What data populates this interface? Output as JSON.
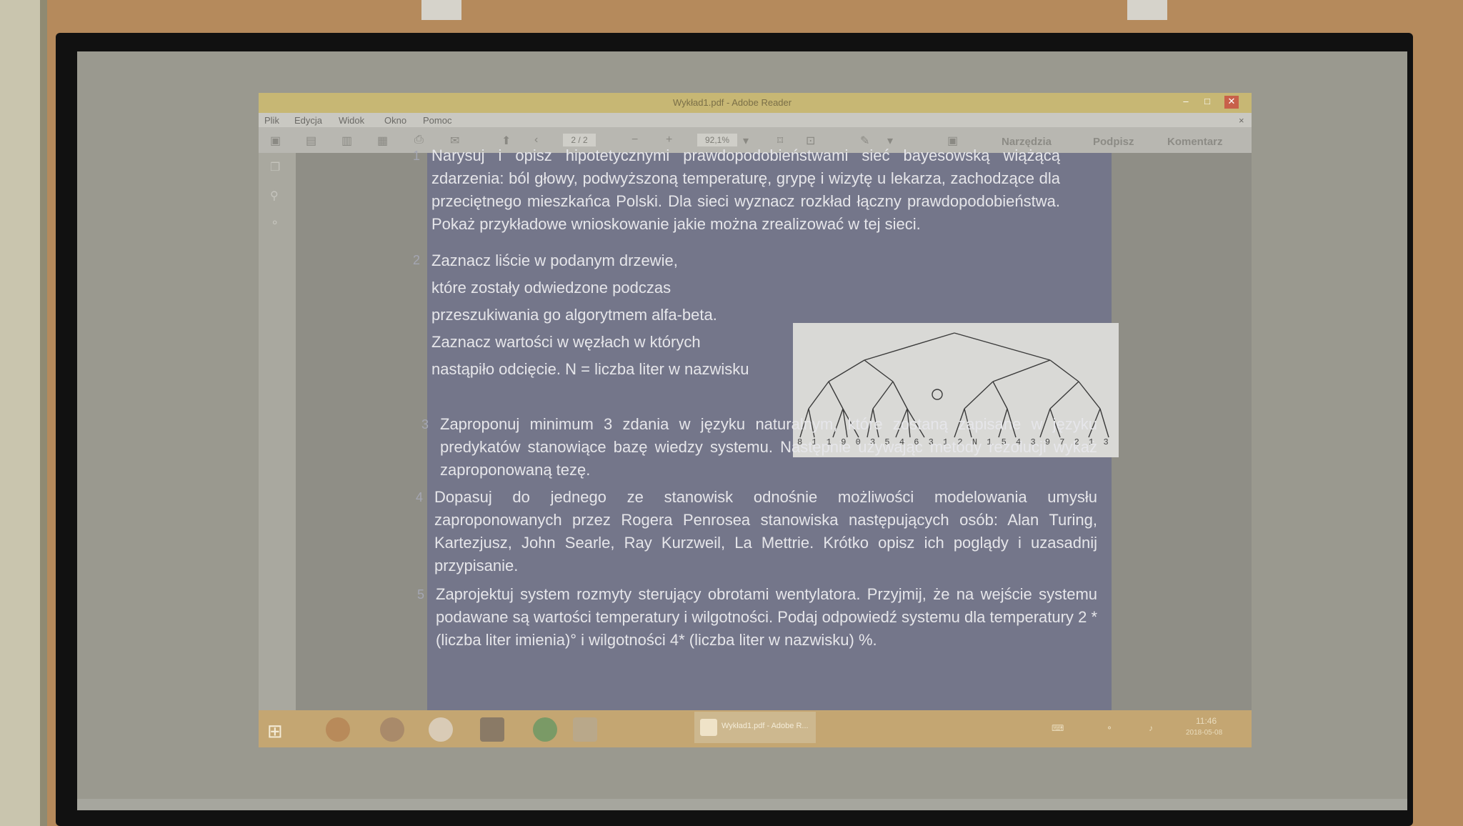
{
  "window": {
    "title": "Wykład1.pdf - Adobe Reader",
    "controls": [
      "–",
      "□",
      "✕"
    ]
  },
  "menu": [
    "Plik",
    "Edycja",
    "Widok",
    "Okno",
    "Pomoc"
  ],
  "toolbar": {
    "page_value": "2 / 2",
    "zoom_value": "92,1%",
    "tools_label": "Narzędzia",
    "sign_label": "Podpisz",
    "comment_label": "Komentarz"
  },
  "document": {
    "tasks": [
      {
        "num": "1",
        "text": "Narysuj i opisz hipotetycznymi prawdopodobieństwami sieć bayesowską wiążącą zdarzenia: ból głowy, podwyższoną temperaturę, grypę i wizytę u lekarza, zachodzące dla przeciętnego mieszkańca Polski. Dla sieci wyznacz rozkład łączny prawdopodobieństwa. Pokaż przykładowe wnioskowanie jakie można zrealizować w tej sieci."
      },
      {
        "num": "2",
        "lines": [
          "Zaznacz liście w podanym drzewie,",
          "które zostały odwiedzone podczas",
          "przeszukiwania go algorytmem alfa-beta.",
          "Zaznacz wartości w węzłach w których",
          "nastąpiło odcięcie. N = liczba liter w nazwisku"
        ]
      },
      {
        "num": "3",
        "text": "Zaproponuj minimum 3 zdania w języku naturalnym, które zostaną zapisane w języku predykatów stanowiące bazę wiedzy systemu. Następnie używając metody rezolucji wykaż zaproponowaną tezę."
      },
      {
        "num": "4",
        "text": "Dopasuj do jednego ze stanowisk odnośnie możliwości modelowania umysłu zaproponowanych przez Rogera Penrosea stanowiska następujących osób: Alan Turing, Kartezjusz, John Searle, Ray Kurzweil, La Mettrie. Krótko opisz ich poglądy i uzasadnij przypisanie."
      },
      {
        "num": "5",
        "text": "Zaprojektuj system rozmyty sterujący obrotami wentylatora. Przyjmij, że na wejście systemu podawane są wartości temperatury i wilgotności. Podaj odpowiedź systemu dla temperatury 2 * (liczba liter imienia)° i wilgotności 4* (liczba liter w nazwisku) %."
      }
    ],
    "tree_leaves": "8 1 1 9 0 3 5 4 6 3 1 2 N 1 5 4 3 9 7 2 1 3",
    "tree_leaf_N": "N"
  },
  "taskbar": {
    "app_label": "Wykład1.pdf - Adobe R...",
    "time": "11:46",
    "date": "2018-05-08"
  }
}
